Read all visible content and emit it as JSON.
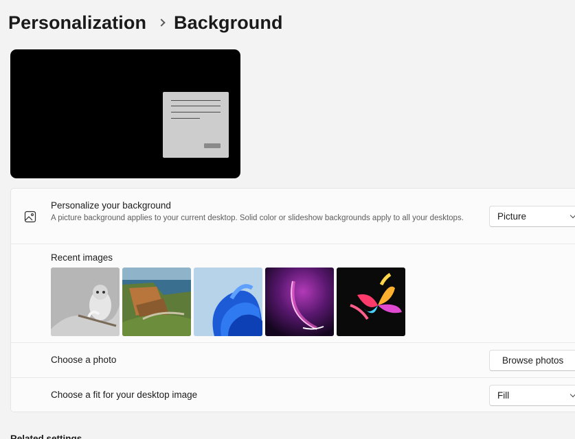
{
  "breadcrumb": {
    "parent": "Personalization",
    "current": "Background"
  },
  "background_row": {
    "title": "Personalize your background",
    "description": "A picture background applies to your current desktop. Solid color or slideshow backgrounds apply to all your desktops.",
    "selected": "Picture",
    "icon": "image-icon"
  },
  "recent_images": {
    "title": "Recent images",
    "items": [
      {
        "name": "owl-on-snowy-branch"
      },
      {
        "name": "coastal-cliffs"
      },
      {
        "name": "blue-bloom-swirl"
      },
      {
        "name": "purple-glow-arc"
      },
      {
        "name": "colorful-abstract-flower"
      }
    ]
  },
  "choose_photo": {
    "title": "Choose a photo",
    "button": "Browse photos"
  },
  "choose_fit": {
    "title": "Choose a fit for your desktop image",
    "selected": "Fill"
  },
  "related": {
    "title": "Related settings"
  },
  "colors": {
    "page_bg": "#f3f3f3",
    "card_bg": "#fbfbfb",
    "preview_bg": "#000000"
  }
}
